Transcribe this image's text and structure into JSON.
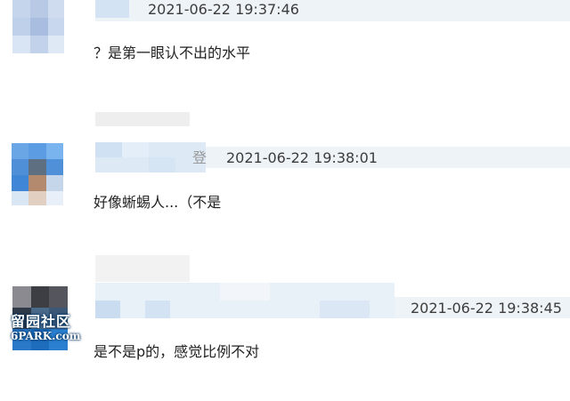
{
  "comments": [
    {
      "timestamp": "2021-06-22 19:37:46",
      "text": "？是第一眼认不出的水平",
      "name_tail": ""
    },
    {
      "timestamp": "2021-06-22 19:38:01",
      "text": "好像蜥蜴人...（不是",
      "name_tail": "登"
    },
    {
      "timestamp": "2021-06-22 19:38:45",
      "text": "是不是p的，感觉比例不对",
      "name_tail": ""
    }
  ],
  "watermark": {
    "cn": "留园社区",
    "en": "6PARK.com"
  },
  "colors": {
    "header_bg": "#eef3f8",
    "avatar_blue": "#4a90d9",
    "text": "#1f1f1f",
    "timestamp": "#3c3c3c"
  }
}
